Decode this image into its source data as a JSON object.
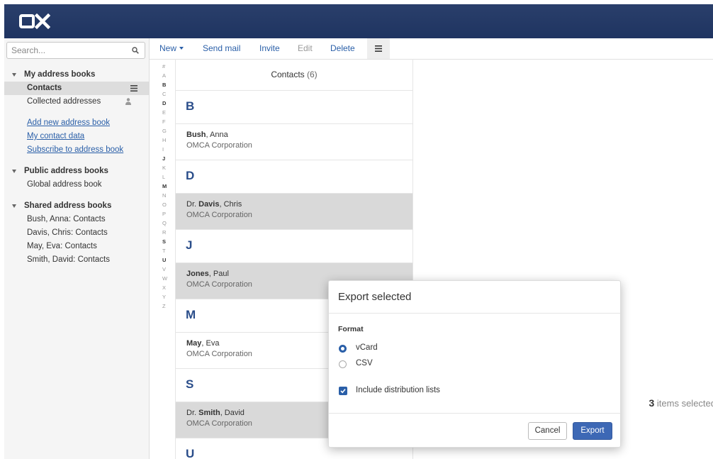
{
  "app": {
    "logo_text": "OX"
  },
  "sidebar": {
    "search_placeholder": "Search...",
    "sections": [
      {
        "title": "My address books",
        "items": [
          "Contacts",
          "Collected addresses"
        ]
      },
      {
        "title": "Public address books",
        "items": [
          "Global address book"
        ]
      },
      {
        "title": "Shared address books",
        "items": [
          "Bush, Anna: Contacts",
          "Davis, Chris: Contacts",
          "May, Eva: Contacts",
          "Smith, David: Contacts"
        ]
      }
    ],
    "links": [
      "Add new address book",
      "My contact data",
      "Subscribe to address book"
    ],
    "selected_item": "Contacts"
  },
  "toolbar": {
    "new_label": "New",
    "send_mail_label": "Send mail",
    "invite_label": "Invite",
    "edit_label": "Edit",
    "delete_label": "Delete"
  },
  "alphabet": {
    "letters": [
      "#",
      "A",
      "B",
      "C",
      "D",
      "E",
      "F",
      "G",
      "H",
      "I",
      "J",
      "K",
      "L",
      "M",
      "N",
      "O",
      "P",
      "Q",
      "R",
      "S",
      "T",
      "U",
      "V",
      "W",
      "X",
      "Y",
      "Z"
    ],
    "active": [
      "B",
      "D",
      "J",
      "M",
      "S",
      "U"
    ]
  },
  "list": {
    "title": "Contacts",
    "count": "(6)",
    "groups": [
      {
        "letter": "B",
        "contacts": [
          {
            "prefix": "",
            "last": "Bush",
            "first": ", Anna",
            "company": "OMCA Corporation",
            "selected": false
          }
        ]
      },
      {
        "letter": "D",
        "contacts": [
          {
            "prefix": "Dr. ",
            "last": "Davis",
            "first": ", Chris",
            "company": "OMCA Corporation",
            "selected": true
          }
        ]
      },
      {
        "letter": "J",
        "contacts": [
          {
            "prefix": "",
            "last": "Jones",
            "first": ", Paul",
            "company": "OMCA Corporation",
            "selected": true
          }
        ]
      },
      {
        "letter": "M",
        "contacts": [
          {
            "prefix": "",
            "last": "May",
            "first": ", Eva",
            "company": "OMCA Corporation",
            "selected": false
          }
        ]
      },
      {
        "letter": "S",
        "contacts": [
          {
            "prefix": "Dr. ",
            "last": "Smith",
            "first": ", David",
            "company": "OMCA Corporation",
            "selected": true
          }
        ]
      },
      {
        "letter": "U",
        "contacts": []
      }
    ]
  },
  "detail": {
    "selected_count": "3",
    "selected_text": " items selected"
  },
  "dialog": {
    "title": "Export selected",
    "format_label": "Format",
    "options": [
      "vCard",
      "CSV"
    ],
    "selected_option": "vCard",
    "include_label": "Include distribution lists",
    "include_checked": true,
    "cancel_label": "Cancel",
    "export_label": "Export"
  },
  "colors": {
    "header": "#1f3461",
    "accent": "#2a5fa8",
    "selected_row": "#d9d9d9"
  }
}
